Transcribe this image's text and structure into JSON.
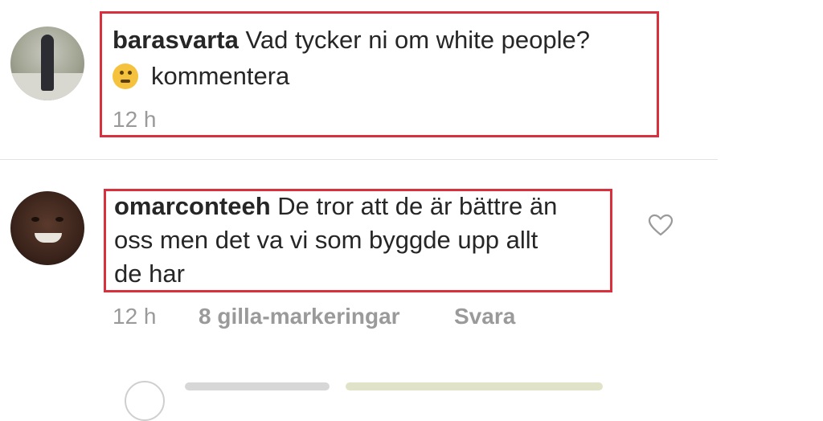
{
  "comments": [
    {
      "username": "barasvarta",
      "text_line1": "Vad tycker ni om white people?",
      "text_line2": "kommentera",
      "emoji": "thinking-face",
      "time": "12 h"
    },
    {
      "username": "omarconteeh",
      "text_line1": "De tror att de är bättre än",
      "text_line2": "oss men det va vi som byggde upp allt",
      "text_line3": "de har",
      "time": "12 h",
      "likes": "8 gilla-markeringar",
      "reply": "Svara"
    }
  ],
  "colors": {
    "highlight": "#d8303c",
    "text": "#262626",
    "meta": "#9a9a9a"
  },
  "icons": {
    "like": "heart-icon"
  }
}
